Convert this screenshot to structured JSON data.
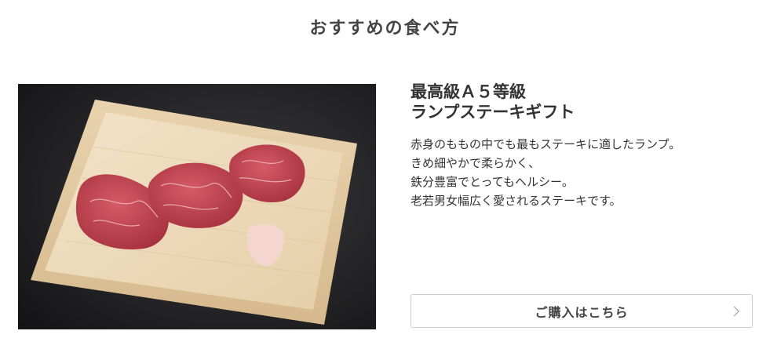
{
  "section": {
    "title": "おすすめの食べ方"
  },
  "product": {
    "name_lines": [
      "最高級Ａ５等級",
      "ランプステーキギフト"
    ],
    "description_lines": [
      "赤身のももの中でも最もステーキに適したランプ。",
      "きめ細やかで柔らかく、",
      "鉄分豊富でとってもヘルシー。",
      "老若男女幅広く愛されるステーキです。"
    ]
  },
  "cta": {
    "label": "ご購入はこちら",
    "icon": "chevron-right-icon"
  },
  "photo": {
    "subject": "steak-gift-box-image"
  },
  "colors": {
    "text": "#333333",
    "border": "#cccccc",
    "background": "#ffffff"
  }
}
